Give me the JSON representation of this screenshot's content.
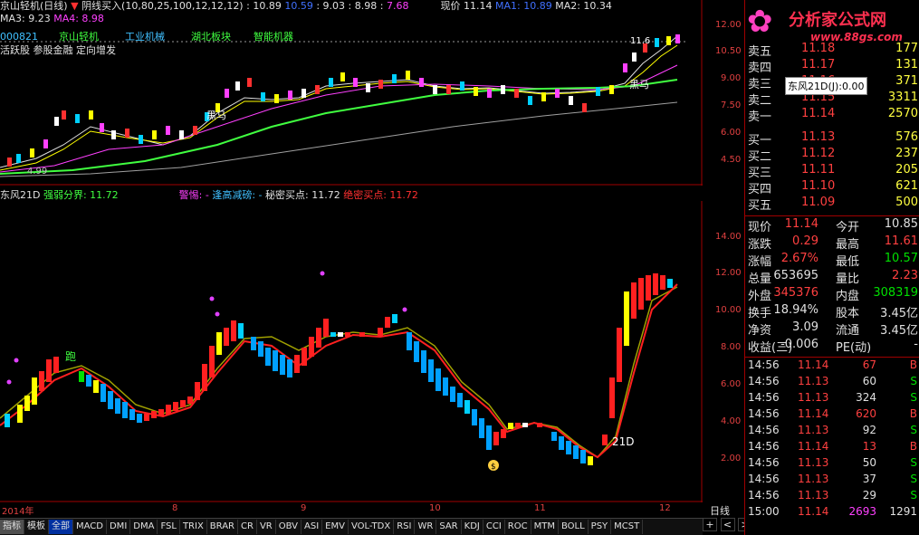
{
  "header": {
    "title": "京山轻机(日线)",
    "arrow_label": "阴线买入(10,80,25,100,12,12,12)",
    "v1": "10.89",
    "v2": "10.59",
    "v3": "9.03",
    "v4": "8.98",
    "v5": "7.68",
    "price_label": "现价 11.14",
    "ma1_label": "MA1: 10.89",
    "ma2_label": "MA2: 10.34",
    "ma3_label": "MA3: 9.23",
    "ma4_label": "MA4: 8.98"
  },
  "tags": {
    "code": "000821",
    "name": "京山轻机",
    "industry": "工业机械",
    "region": "湖北板块",
    "concept": "智能机器",
    "desc": "活跃股 参股金融 定向增发"
  },
  "logo": {
    "title": "分析家公式网",
    "url": "www.88gs.com"
  },
  "tooltip": "东风21D(J):0.00",
  "indicator": {
    "name": "东风21D",
    "split_label": "强弱分界: 11.72",
    "warn_label": "警惕: -",
    "high_label": "逢高减磅: -",
    "secret_label": "秘密买点: 11.72",
    "ultimate_label": "绝密买点: 11.72",
    "marker_run": "跑",
    "marker_21d": "21D",
    "marker_money": "$"
  },
  "price_axis": [
    "12.00",
    "10.50",
    "9.00",
    "7.50",
    "6.00",
    "4.50"
  ],
  "ind_axis": [
    "14.00",
    "12.00",
    "10.00",
    "8.00",
    "6.00",
    "4.00",
    "2.00"
  ],
  "date_axis": [
    "2014年",
    "8",
    "9",
    "10",
    "11",
    "12"
  ],
  "chart_text": {
    "black_horse": "黑马",
    "low_label": "4.99",
    "high_label": "11.6"
  },
  "period_label": "日线",
  "order_book": {
    "sell": [
      {
        "label": "卖五",
        "price": "11.18",
        "vol": "177"
      },
      {
        "label": "卖四",
        "price": "11.17",
        "vol": "131"
      },
      {
        "label": "卖三",
        "price": "11.16",
        "vol": "371"
      },
      {
        "label": "卖二",
        "price": "11.15",
        "vol": "3311"
      },
      {
        "label": "卖一",
        "price": "11.14",
        "vol": "2570"
      }
    ],
    "buy": [
      {
        "label": "买一",
        "price": "11.13",
        "vol": "576"
      },
      {
        "label": "买二",
        "price": "11.12",
        "vol": "237"
      },
      {
        "label": "买三",
        "price": "11.11",
        "vol": "205"
      },
      {
        "label": "买四",
        "price": "11.10",
        "vol": "621"
      },
      {
        "label": "买五",
        "price": "11.09",
        "vol": "500"
      }
    ]
  },
  "stats": [
    {
      "l1": "现价",
      "v1": "11.14",
      "c1": "red",
      "l2": "今开",
      "v2": "10.85",
      "c2": "wht"
    },
    {
      "l1": "涨跌",
      "v1": "0.29",
      "c1": "red",
      "l2": "最高",
      "v2": "11.61",
      "c2": "red"
    },
    {
      "l1": "涨幅",
      "v1": "2.67%",
      "c1": "red",
      "l2": "最低",
      "v2": "10.57",
      "c2": "grn"
    },
    {
      "l1": "总量",
      "v1": "653695",
      "c1": "wht",
      "l2": "量比",
      "v2": "2.23",
      "c2": "red"
    },
    {
      "l1": "外盘",
      "v1": "345376",
      "c1": "red",
      "l2": "内盘",
      "v2": "308319",
      "c2": "grn"
    },
    {
      "l1": "换手",
      "v1": "18.94%",
      "c1": "wht",
      "l2": "股本",
      "v2": "3.45亿",
      "c2": "wht"
    },
    {
      "l1": "净资",
      "v1": "3.09",
      "c1": "wht",
      "l2": "流通",
      "v2": "3.45亿",
      "c2": "wht"
    },
    {
      "l1": "收益(三)",
      "v1": "-0.006",
      "c1": "wht",
      "l2": "PE(动)",
      "v2": "-",
      "c2": "wht"
    }
  ],
  "ticks": [
    {
      "time": "14:56",
      "price": "11.14",
      "vol": "67",
      "side": "B"
    },
    {
      "time": "14:56",
      "price": "11.13",
      "vol": "60",
      "side": "S"
    },
    {
      "time": "14:56",
      "price": "11.13",
      "vol": "324",
      "side": "S"
    },
    {
      "time": "14:56",
      "price": "11.14",
      "vol": "620",
      "side": "B"
    },
    {
      "time": "14:56",
      "price": "11.13",
      "vol": "92",
      "side": "S"
    },
    {
      "time": "14:56",
      "price": "11.14",
      "vol": "13",
      "side": "B"
    },
    {
      "time": "14:56",
      "price": "11.13",
      "vol": "50",
      "side": "S"
    },
    {
      "time": "14:56",
      "price": "11.13",
      "vol": "37",
      "side": "S"
    },
    {
      "time": "14:56",
      "price": "11.13",
      "vol": "29",
      "side": "S"
    },
    {
      "time": "15:00",
      "price": "11.14",
      "vol": "2693",
      "side": "1291"
    }
  ],
  "tabs": [
    "指标",
    "模板",
    "全部",
    "MACD",
    "DMI",
    "DMA",
    "FSL",
    "TRIX",
    "BRAR",
    "CR",
    "VR",
    "OBV",
    "ASI",
    "EMV",
    "VOL-TDX",
    "RSI",
    "WR",
    "SAR",
    "KDJ",
    "CCI",
    "ROC",
    "MTM",
    "BOLL",
    "PSY",
    "MCST"
  ],
  "nav_buttons": [
    "+",
    "<",
    ">"
  ],
  "colors": {
    "rise": "#ff3030",
    "fall": "#00d000",
    "bg": "#000000",
    "grid": "#800000",
    "accent_yellow": "#ffff00",
    "accent_blue": "#1e90ff"
  }
}
